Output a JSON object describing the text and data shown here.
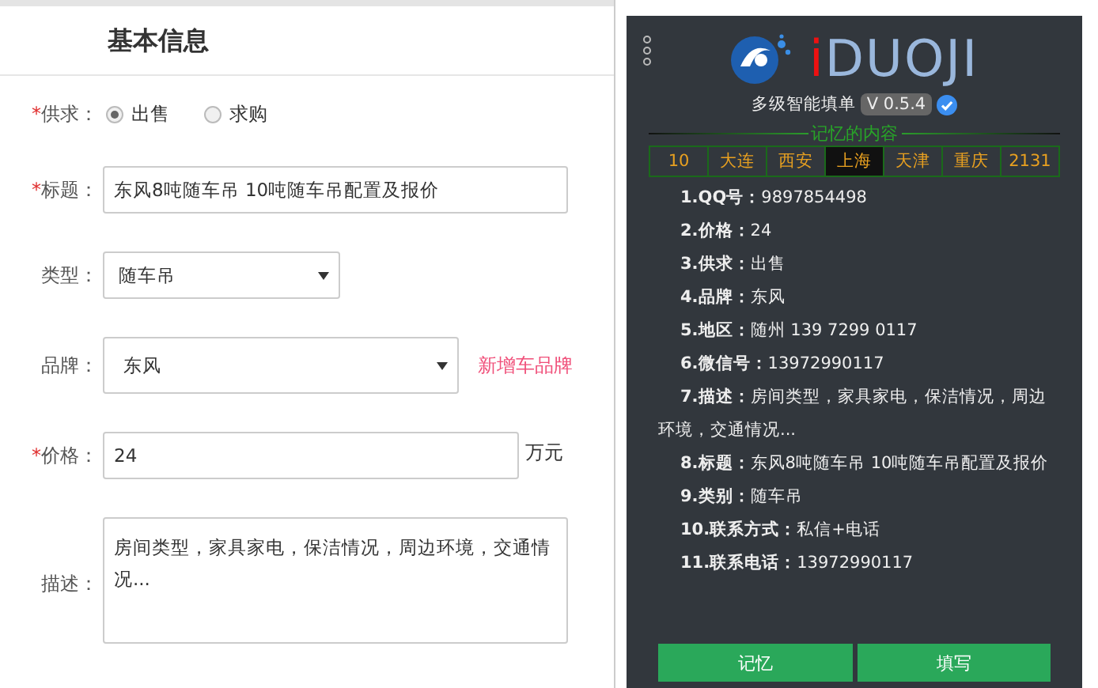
{
  "form": {
    "title": "基本信息",
    "fields": [
      {
        "kind": "radio",
        "mark": "*",
        "label": "供求：",
        "options": [
          {
            "label": "出售",
            "selected": true
          },
          {
            "label": "求购",
            "selected": false
          }
        ]
      },
      {
        "kind": "text",
        "mark": "*",
        "label": "标题：",
        "value": "东风8吨随车吊 10吨随车吊配置及报价"
      },
      {
        "kind": "select",
        "label": "类型：",
        "value": "随车吊"
      },
      {
        "kind": "select_wide",
        "label": "品牌：",
        "value": "东风",
        "link": "新增车品牌"
      },
      {
        "kind": "price",
        "mark": "*",
        "label": "价格：",
        "value": "24",
        "unit": "万元"
      },
      {
        "kind": "textarea",
        "label": "描述：",
        "value": "房间类型，家具家电，保洁情况，周边环境，交通情况..."
      }
    ]
  },
  "panel": {
    "logo": "iDUOJI",
    "subtitle": "多级智能填单",
    "version": "V 0.5.4",
    "memory_title": "记忆的内容",
    "memory_tabs": [
      {
        "label": "10",
        "selected": false
      },
      {
        "label": "大连",
        "selected": false
      },
      {
        "label": "西安",
        "selected": false
      },
      {
        "label": "上海",
        "selected": true
      },
      {
        "label": "天津",
        "selected": false
      },
      {
        "label": "重庆",
        "selected": false
      },
      {
        "label": "2131",
        "selected": false
      }
    ],
    "entries": [
      {
        "number": "1.",
        "label": "QQ号：",
        "value": "9897854498"
      },
      {
        "number": "2.",
        "label": "价格：",
        "value": "24"
      },
      {
        "number": "3.",
        "label": "供求：",
        "value": "出售"
      },
      {
        "number": "4.",
        "label": "品牌：",
        "value": "东风"
      },
      {
        "number": "5.",
        "label": "地区：",
        "value": "随州 139 7299 0117"
      },
      {
        "number": "6.",
        "label": "微信号：",
        "value": "13972990117"
      },
      {
        "number": "7.",
        "label": "描述：",
        "value": "房间类型，家具家电，保洁情况，周边环境，交通情况..."
      },
      {
        "number": "8.",
        "label": "标题：",
        "value": "东风8吨随车吊 10吨随车吊配置及报价"
      },
      {
        "number": "9.",
        "label": "类别：",
        "value": "随车吊"
      },
      {
        "number": "10.",
        "label": "联系方式：",
        "value": "私信+电话"
      },
      {
        "number": "11.",
        "label": "联系电话：",
        "value": "13972990117"
      }
    ],
    "buttons": [
      "记忆",
      "填写"
    ]
  }
}
